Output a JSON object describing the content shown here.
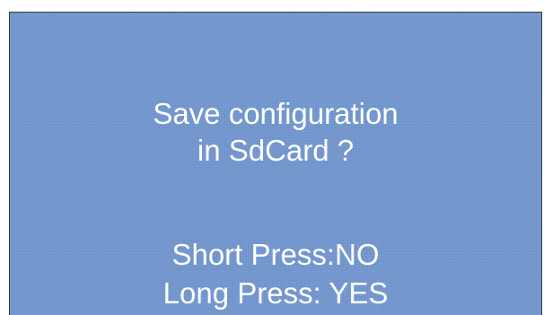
{
  "dialog": {
    "question_line1": "Save configuration",
    "question_line2": "in SdCard ?",
    "short_press": "Short Press:NO",
    "long_press": "Long Press: YES"
  },
  "colors": {
    "background": "#7094cc",
    "text": "#ffffff",
    "border": "#3a3a3a"
  }
}
